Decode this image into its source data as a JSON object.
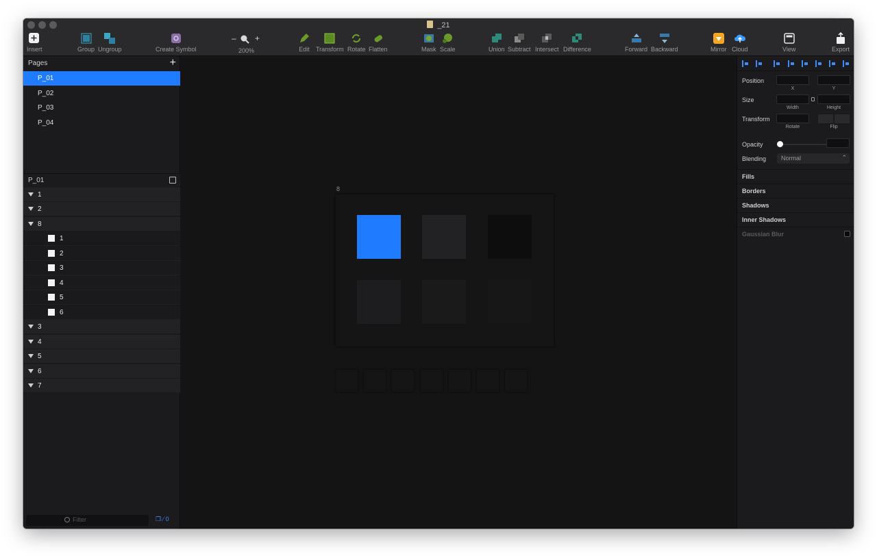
{
  "window": {
    "title": "_21"
  },
  "toolbar": {
    "insert": "Insert",
    "group": "Group",
    "ungroup": "Ungroup",
    "create_symbol": "Create Symbol",
    "zoom_minus": "–",
    "zoom_plus": "+",
    "zoom_level": "200%",
    "edit": "Edit",
    "transform": "Transform",
    "rotate": "Rotate",
    "flatten": "Flatten",
    "mask": "Mask",
    "scale": "Scale",
    "union": "Union",
    "subtract": "Subtract",
    "intersect": "Intersect",
    "difference": "Difference",
    "forward": "Forward",
    "backward": "Backward",
    "mirror": "Mirror",
    "cloud": "Cloud",
    "view": "View",
    "export": "Export"
  },
  "pages": {
    "header": "Pages",
    "add": "+",
    "items": [
      {
        "label": "P_01",
        "selected": true
      },
      {
        "label": "P_02",
        "selected": false
      },
      {
        "label": "P_03",
        "selected": false
      },
      {
        "label": "P_04",
        "selected": false
      }
    ]
  },
  "layers": {
    "header": "P_01",
    "groups_top": [
      "1",
      "2",
      "8"
    ],
    "children": [
      "1",
      "2",
      "3",
      "4",
      "5",
      "6"
    ],
    "groups_bottom": [
      "3",
      "4",
      "5",
      "6",
      "7"
    ],
    "filter_placeholder": "Filter",
    "bottom_count": "0"
  },
  "canvas": {
    "artboard_label": "8",
    "tiles": [
      {
        "color": "#1f7bff"
      },
      {
        "color": "#222224"
      },
      {
        "color": "#0d0d0d"
      },
      {
        "color": "#1d1d1f"
      },
      {
        "color": "#1a1a1a"
      },
      {
        "color": "#171717"
      }
    ],
    "slot_count": 7
  },
  "inspector": {
    "position": "Position",
    "x": "X",
    "y": "Y",
    "size": "Size",
    "width": "Width",
    "height": "Height",
    "transform": "Transform",
    "rotate": "Rotate",
    "flip": "Flip",
    "opacity": "Opacity",
    "blending": "Blending",
    "blending_value": "Normal",
    "fills": "Fills",
    "borders": "Borders",
    "shadows": "Shadows",
    "inner_shadows": "Inner Shadows",
    "gaussian_blur": "Gaussian Blur"
  },
  "colors": {
    "accent": "#1f7bff",
    "background": "#161616",
    "panel": "#1b1b1d"
  }
}
